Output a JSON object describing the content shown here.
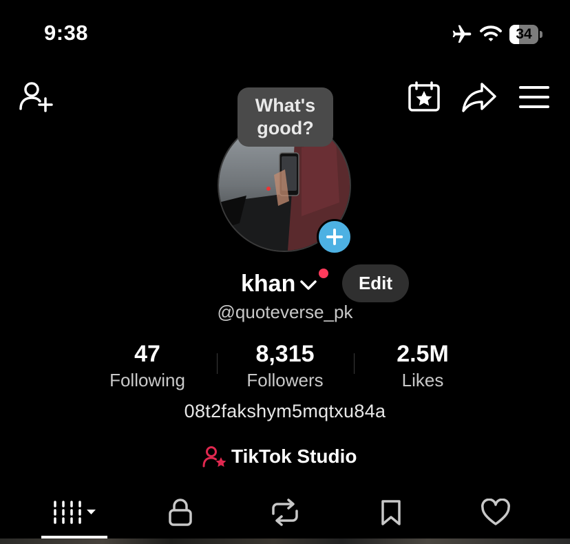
{
  "status_bar": {
    "time": "9:38",
    "battery_level": "34",
    "icons": [
      "airplane-icon",
      "wifi-icon",
      "battery-icon"
    ]
  },
  "top_bar": {
    "icons": [
      "add-friend-icon",
      "calendar-star-icon",
      "share-icon",
      "menu-icon"
    ]
  },
  "profile": {
    "note_bubble": "What's good?",
    "display_name": "khan",
    "edit_label": "Edit",
    "username": "@quoteverse_pk",
    "bio": "08t2fakshym5mqtxu84a",
    "studio_label": "TikTok Studio"
  },
  "stats": [
    {
      "value": "47",
      "label": "Following"
    },
    {
      "value": "8,315",
      "label": "Followers"
    },
    {
      "value": "2.5M",
      "label": "Likes"
    }
  ],
  "tabs": [
    {
      "name": "videos",
      "icon": "grid-icon",
      "selected": true
    },
    {
      "name": "private",
      "icon": "lock-icon",
      "selected": false
    },
    {
      "name": "reposts",
      "icon": "repost-icon",
      "selected": false
    },
    {
      "name": "saved",
      "icon": "bookmark-icon",
      "selected": false
    },
    {
      "name": "liked",
      "icon": "heart-icon",
      "selected": false
    }
  ],
  "colors": {
    "background": "#000000",
    "add_story_button": "#4db1e3",
    "notification_dot": "#ff3b5c",
    "studio_icon": "#e0284f",
    "edit_button_bg": "#2f2f2f"
  }
}
